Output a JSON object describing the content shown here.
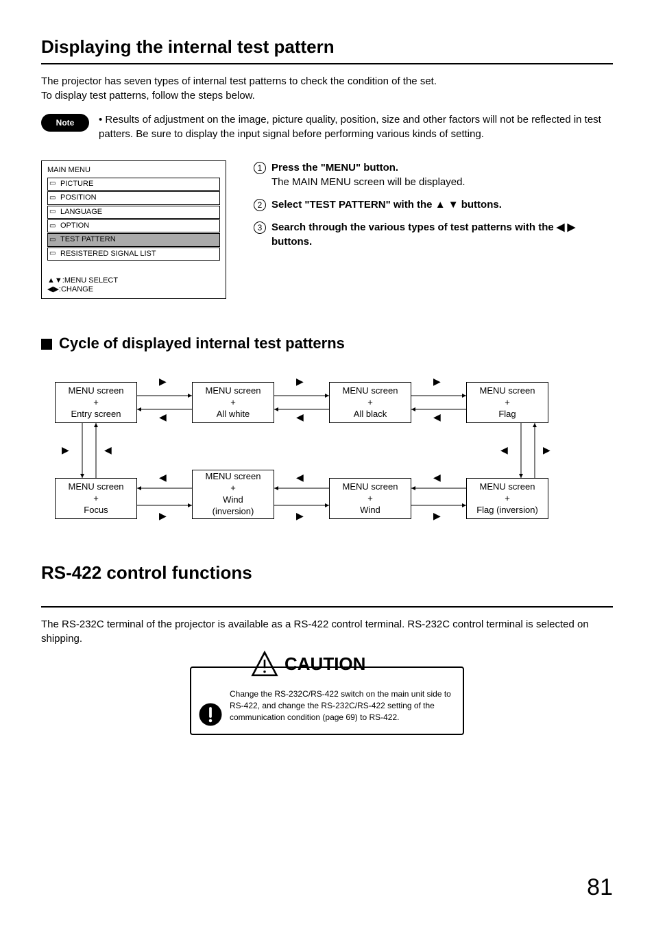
{
  "header": {
    "title": "Displaying the internal test pattern",
    "intro1": "The projector has seven types of internal test patterns to check the condition of the set.",
    "intro2": "To display test patterns, follow the steps below."
  },
  "note": {
    "label": "Note",
    "bullet": "• Results of adjustment on the image, picture quality, position, size and other factors will not be reflected in test patters.  Be sure to display the input signal before performing various kinds of setting."
  },
  "menu": {
    "title": "MAIN MENU",
    "items": [
      {
        "icon": "▭",
        "label": "PICTURE"
      },
      {
        "icon": "▭",
        "label": "POSITION"
      },
      {
        "icon": "▭",
        "label": "LANGUAGE"
      },
      {
        "icon": "▭",
        "label": "OPTION"
      },
      {
        "icon": "▭",
        "label": "TEST PATTERN"
      },
      {
        "icon": "▭",
        "label": "RESISTERED SIGNAL LIST"
      }
    ],
    "footer1": "▲▼:MENU SELECT",
    "footer2": "◀▶:CHANGE"
  },
  "steps": {
    "s1": {
      "title": "Press the \"MENU\" button.",
      "sub": "The MAIN MENU screen will be displayed."
    },
    "s2": {
      "title": "Select \"TEST PATTERN\" with the ▲ ▼ buttons."
    },
    "s3": {
      "title": "Search through the various types of test patterns with the ◀ ▶ buttons."
    }
  },
  "cycle": {
    "heading": "Cycle of displayed internal test patterns",
    "boxes": [
      "MENU screen\n+\nEntry screen",
      "MENU screen\n+\nAll white",
      "MENU screen\n+\nAll black",
      "MENU screen\n+\nFlag",
      "MENU screen\n+\nFocus",
      "MENU screen\n+\nWind\n(inversion)",
      "MENU screen\n+\nWind",
      "MENU screen\n+\nFlag (inversion)"
    ]
  },
  "rs422": {
    "title": "RS-422 control functions",
    "intro": "The RS-232C terminal of the projector is available as a RS-422 control terminal. RS-232C control terminal is selected on shipping.",
    "caution_label": "CAUTION",
    "caution_text": "Change the RS-232C/RS-422 switch on the main unit side to RS-422, and change the RS-232C/RS-422 setting of the communication condition (page 69) to RS-422."
  },
  "page_number": "81"
}
